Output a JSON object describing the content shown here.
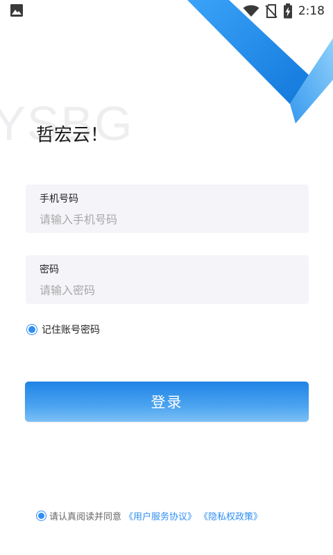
{
  "status_bar": {
    "time": "2:18",
    "icons": [
      "gallery-icon",
      "wifi-icon",
      "no-sim-icon",
      "battery-charging-icon"
    ]
  },
  "watermark": "YSBG",
  "welcome": "哲宏云！",
  "phone_field": {
    "label": "手机号码",
    "placeholder": "请输入手机号码"
  },
  "password_field": {
    "label": "密码",
    "placeholder": "请输入密码"
  },
  "remember": {
    "label": "记住账号密码",
    "checked": true
  },
  "login_button": {
    "label": "登录"
  },
  "agreement": {
    "prefix": "请认真阅读并同意",
    "user_agreement": "《用户服务协议》",
    "privacy_policy": "《隐私权政策》",
    "checked": true
  },
  "colors": {
    "accent": "#2f8ef2",
    "button_top": "#1f84e6",
    "button_bottom": "#7cc0f6",
    "field_background": "#f5f4f9"
  }
}
